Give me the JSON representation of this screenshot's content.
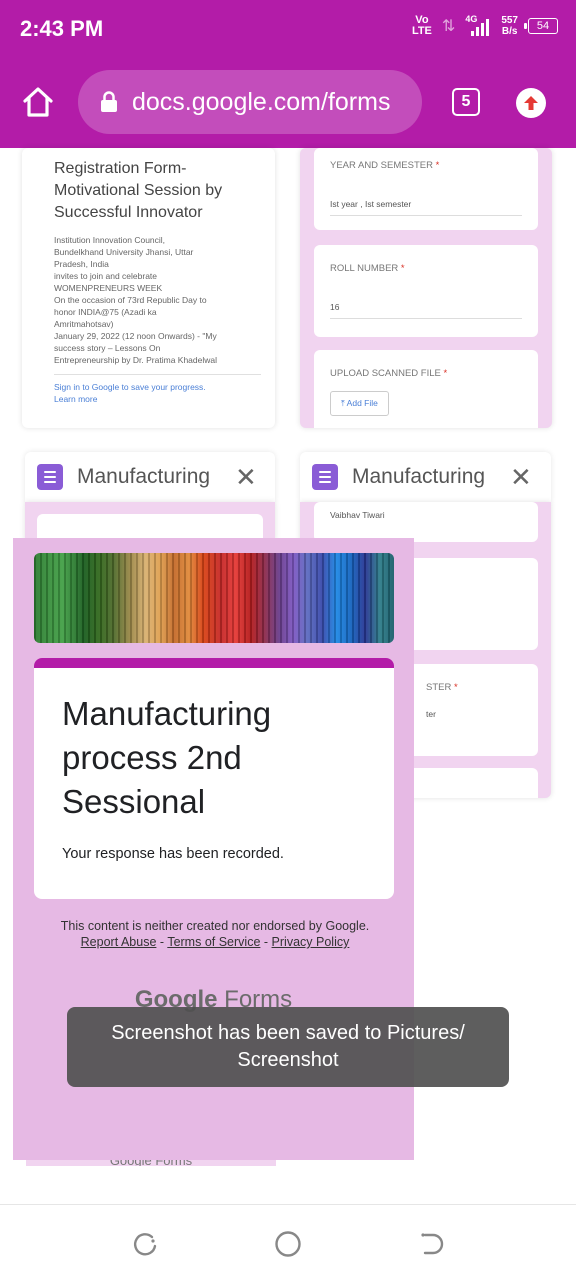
{
  "status_bar": {
    "time": "2:43 PM",
    "volte_top": "Vo",
    "volte_bottom": "LTE",
    "network": "4G",
    "speed_value": "557",
    "speed_unit": "B/s",
    "battery": "54"
  },
  "browser": {
    "url": "docs.google.com/forms",
    "tab_count": "5",
    "theme_color": "#b31ca8"
  },
  "tabs": {
    "registration": {
      "title": "Registration Form- Motivational Session by Successful Innovator",
      "description": [
        "Institution Innovation Council,",
        "Bundelkhand University Jhansi, Uttar",
        "Pradesh, India",
        "invites to join and celebrate",
        "WOMENPRENEURS WEEK",
        "On the occasion of 73rd Republic Day to",
        "honor INDIA@75 (Azadi ka",
        "Amritmahotsav)",
        "January 29, 2022 (12 noon Onwards) - \"My",
        "success story – Lessons On",
        "Entrepreneurship by Dr. Pratima Khadelwal"
      ],
      "signin_text": "Sign in to Google to save your progress.",
      "learn_more": "Learn more"
    },
    "fields": {
      "year_label": "YEAR AND SEMESTER",
      "year_value": "Ist year , Ist semester",
      "roll_label": "ROLL NUMBER",
      "roll_value": "16",
      "upload_label": "UPLOAD SCANNED FILE",
      "add_file": "Add File",
      "required_mark": "*"
    },
    "left_tab_title": "Manufacturing",
    "right_tab_title": "Manufacturing",
    "right_partial": {
      "name_value": "Vaibhav Tiwari",
      "partial_label": "STER",
      "partial_value": "ter"
    },
    "ghost_footer": "Google Forms"
  },
  "form": {
    "title": "Manufacturing process 2nd Sessional",
    "message": "Your response has been recorded.",
    "disclaimer_prefix": "This content is neither created nor endorsed by Google.",
    "report_abuse": "Report Abuse",
    "terms": "Terms of Service",
    "privacy": "Privacy Policy",
    "separator": "-",
    "logo_google": "Google",
    "logo_forms": "Forms"
  },
  "toast": {
    "message": "Screenshot has been saved to  Pictures/ Screenshot"
  }
}
